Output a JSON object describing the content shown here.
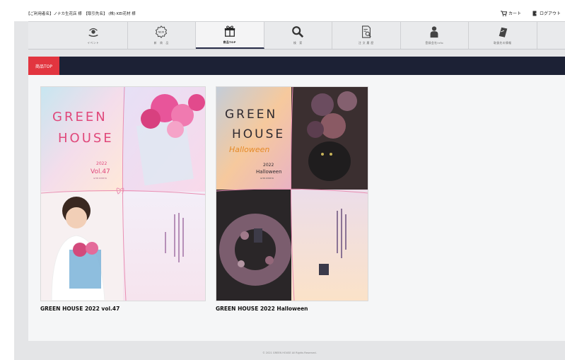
{
  "header": {
    "info_text": "【ご利用者名】ノナカ生花店 様　【取引先名】 (株) KEI花材 様",
    "cart_label": "カート",
    "logout_label": "ログアウト"
  },
  "nav": {
    "items": [
      {
        "label": "イベント",
        "icon": "event-icon"
      },
      {
        "label": "新　商　品",
        "icon": "new-badge-icon"
      },
      {
        "label": "商品TOP",
        "icon": "gift-box-icon",
        "active": true
      },
      {
        "label": "検　索",
        "icon": "search-icon"
      },
      {
        "label": "注 文 履 歴",
        "icon": "order-history-icon"
      },
      {
        "label": "登録会社info",
        "icon": "person-icon"
      },
      {
        "label": "取扱先の情報",
        "icon": "notebook-icon"
      }
    ]
  },
  "breadcrumb": {
    "label": "商品TOP"
  },
  "catalogs": [
    {
      "title": "GREEN HOUSE 2022 vol.47",
      "cover_line1": "GREEN",
      "cover_line2": "HOUSE",
      "cover_year": "2022",
      "cover_sub": "Vol.47",
      "cover_code": "GHB 678876"
    },
    {
      "title": "GREEN HOUSE 2022 Halloween",
      "cover_line1": "GREEN",
      "cover_line2": "HOUSE",
      "cover_script": "Halloween",
      "cover_year": "2022",
      "cover_sub": "Halloween",
      "cover_code": "GHB 678876"
    }
  ],
  "footer": {
    "copyright": "© 2021 GREEN HOUSE All Rights Reserved."
  },
  "colors": {
    "nav_dark": "#1c2135",
    "accent_red": "#e2353f",
    "panel": "#f5f6f7"
  }
}
